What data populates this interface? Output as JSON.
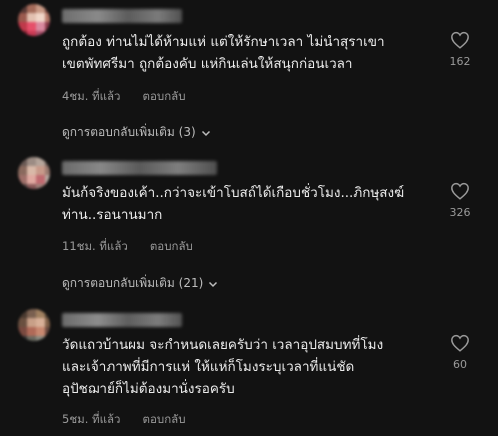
{
  "colors": {
    "background": "#121212",
    "text": "#ececec",
    "muted": "#9a9a9a"
  },
  "comments": [
    {
      "text_lines": [
        "ถูกต้อง ท่านไม่ได้ห้ามแห่ แต่ให้รักษาเวลา ไม่นำสุราเขา",
        "เขตพัทศรีมา ถูกต้องคับ แห่กินเล่นให้สนุกก่อนเวลา"
      ],
      "time": "4ชม. ที่แล้ว",
      "reply_label": "ตอบกลับ",
      "like_count": "162",
      "more_replies": "ดูการตอบกลับเพิ่มเติม (3)"
    },
    {
      "text_lines": [
        "มันก้จริงของเค้า..กว่าจะเข้าโบสถ์ได้เกือบชั่วโมง...ภิกษุสงฆ์",
        "ท่าน..รอนานมาก"
      ],
      "time": "11ชม. ที่แล้ว",
      "reply_label": "ตอบกลับ",
      "like_count": "326",
      "more_replies": "ดูการตอบกลับเพิ่มเติม (21)"
    },
    {
      "text_lines": [
        "วัดแถวบ้านผม จะกำหนดเลยครับว่า เวลาอุปสมบทที่โมง",
        "และเจ้าภาพที่มีการแห่ ให้แห่ก็โมงระบุเวลาที่แน่ชัด",
        "อุปัชฌาย์ก็ไม่ต้องมานั่งรอครับ"
      ],
      "time": "5ชม. ที่แล้ว",
      "reply_label": "ตอบกลับ",
      "like_count": "60"
    }
  ]
}
